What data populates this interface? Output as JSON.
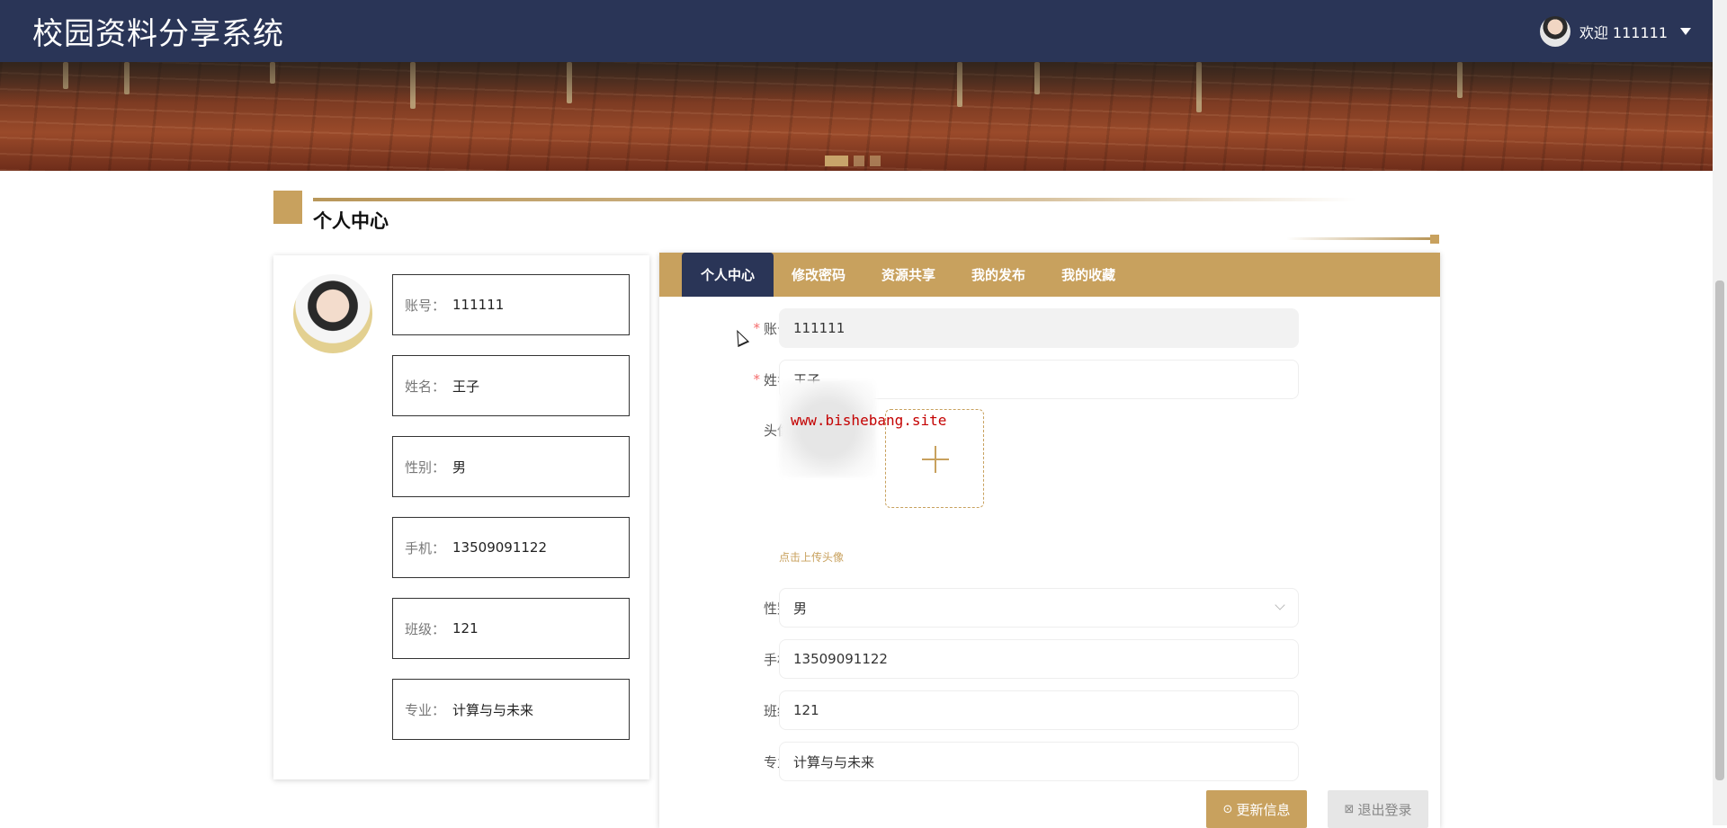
{
  "app": {
    "title": "校园资料分享系统"
  },
  "header": {
    "welcome": "欢迎 111111"
  },
  "section": {
    "title": "个人中心"
  },
  "profile": {
    "fields": [
      {
        "key": "账号：",
        "value": "111111"
      },
      {
        "key": "姓名：",
        "value": "王子"
      },
      {
        "key": "性别：",
        "value": "男"
      },
      {
        "key": "手机：",
        "value": "13509091122"
      },
      {
        "key": "班级：",
        "value": "121"
      },
      {
        "key": "专业：",
        "value": "计算与与未来"
      }
    ]
  },
  "tabs": [
    "个人中心",
    "修改密码",
    "资源共享",
    "我的发布",
    "我的收藏"
  ],
  "form": {
    "account": {
      "label": "账号",
      "required": "*",
      "value": "111111"
    },
    "name": {
      "label": "姓名",
      "required": "*",
      "value": "王子"
    },
    "avatar": {
      "label": "头像",
      "watermark": "www.bishebang.site",
      "hint": "点击上传头像"
    },
    "gender": {
      "label": "性别",
      "value": "男"
    },
    "phone": {
      "label": "手机",
      "value": "13509091122"
    },
    "class": {
      "label": "班级",
      "value": "121"
    },
    "major": {
      "label": "专业",
      "value": "计算与与未来"
    }
  },
  "buttons": {
    "update": {
      "icon": "⊙",
      "label": "更新信息"
    },
    "logout": {
      "icon": "⊠",
      "label": "退出登录"
    }
  },
  "colors": {
    "accent": "#c8a15e",
    "header": "#2a3557"
  }
}
